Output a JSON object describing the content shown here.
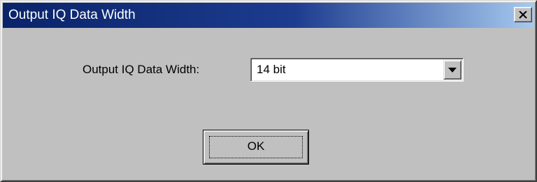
{
  "window": {
    "title": "Output IQ Data Width",
    "close_icon": "close-x-icon"
  },
  "form": {
    "label": "Output IQ Data Width:",
    "selected_value": "14 bit",
    "dropdown_icon": "triangle-down-icon"
  },
  "actions": {
    "ok_label": "OK"
  },
  "colors": {
    "titlebar_start": "#0a246a",
    "titlebar_end": "#a6caf0",
    "face": "#c0c0c0"
  }
}
